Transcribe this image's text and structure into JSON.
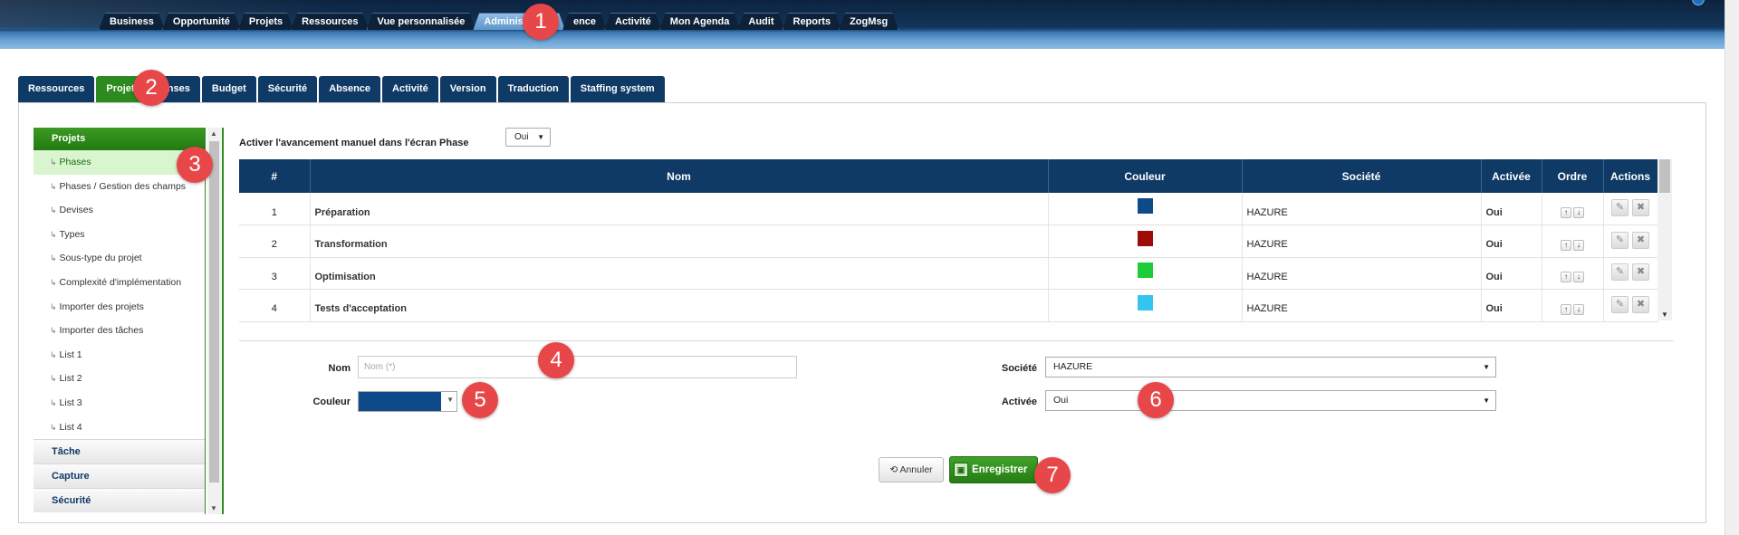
{
  "top_tabs": [
    "Business",
    "Opportunité",
    "Projets",
    "Ressources",
    "Vue personnalisée",
    "Administration",
    "ence",
    "Activité",
    "Mon Agenda",
    "Audit",
    "Reports",
    "ZogMsg"
  ],
  "top_tab_active_index": 5,
  "sub_tabs": [
    "Ressources",
    "Projets",
    "enses",
    "Budget",
    "Sécurité",
    "Absence",
    "Activité",
    "Version",
    "Traduction",
    "Staffing system"
  ],
  "sub_tab_active_index": 1,
  "tree": {
    "header": "Projets",
    "items": [
      "Phases",
      "Phases / Gestion des champs",
      "Devises",
      "Types",
      "Sous-type du projet",
      "Complexité d'implémentation",
      "Importer des projets",
      "Importer des tâches",
      "List 1",
      "List 2",
      "List 3",
      "List 4"
    ],
    "active_index": 0,
    "groups": [
      "Tâche",
      "Capture",
      "Sécurité"
    ]
  },
  "option": {
    "label": "Activer l'avancement manuel dans l'écran Phase",
    "value": "Oui"
  },
  "table": {
    "columns": [
      "#",
      "Nom",
      "Couleur",
      "Société",
      "Activée",
      "Ordre",
      "Actions"
    ],
    "rows": [
      {
        "num": "1",
        "name": "Préparation",
        "color": "#0f4a8a",
        "company": "HAZURE",
        "active": "Oui"
      },
      {
        "num": "2",
        "name": "Transformation",
        "color": "#9e0b0b",
        "company": "HAZURE",
        "active": "Oui"
      },
      {
        "num": "3",
        "name": "Optimisation",
        "color": "#1ecc3a",
        "company": "HAZURE",
        "active": "Oui"
      },
      {
        "num": "4",
        "name": "Tests d'acceptation",
        "color": "#33c4ef",
        "company": "HAZURE",
        "active": "Oui"
      }
    ]
  },
  "form": {
    "nom_label": "Nom",
    "nom_placeholder": "Nom (*)",
    "couleur_label": "Couleur",
    "couleur_value": "#0f4a8a",
    "societe_label": "Société",
    "societe_value": "HAZURE",
    "activee_label": "Activée",
    "activee_value": "Oui"
  },
  "buttons": {
    "cancel": "Annuler",
    "save": "Enregistrer"
  },
  "badges": [
    "1",
    "2",
    "3",
    "4",
    "5",
    "6",
    "7"
  ],
  "colors": {
    "navy": "#0f3a66",
    "green": "#2d8a1e",
    "badge": "#e8474a"
  }
}
